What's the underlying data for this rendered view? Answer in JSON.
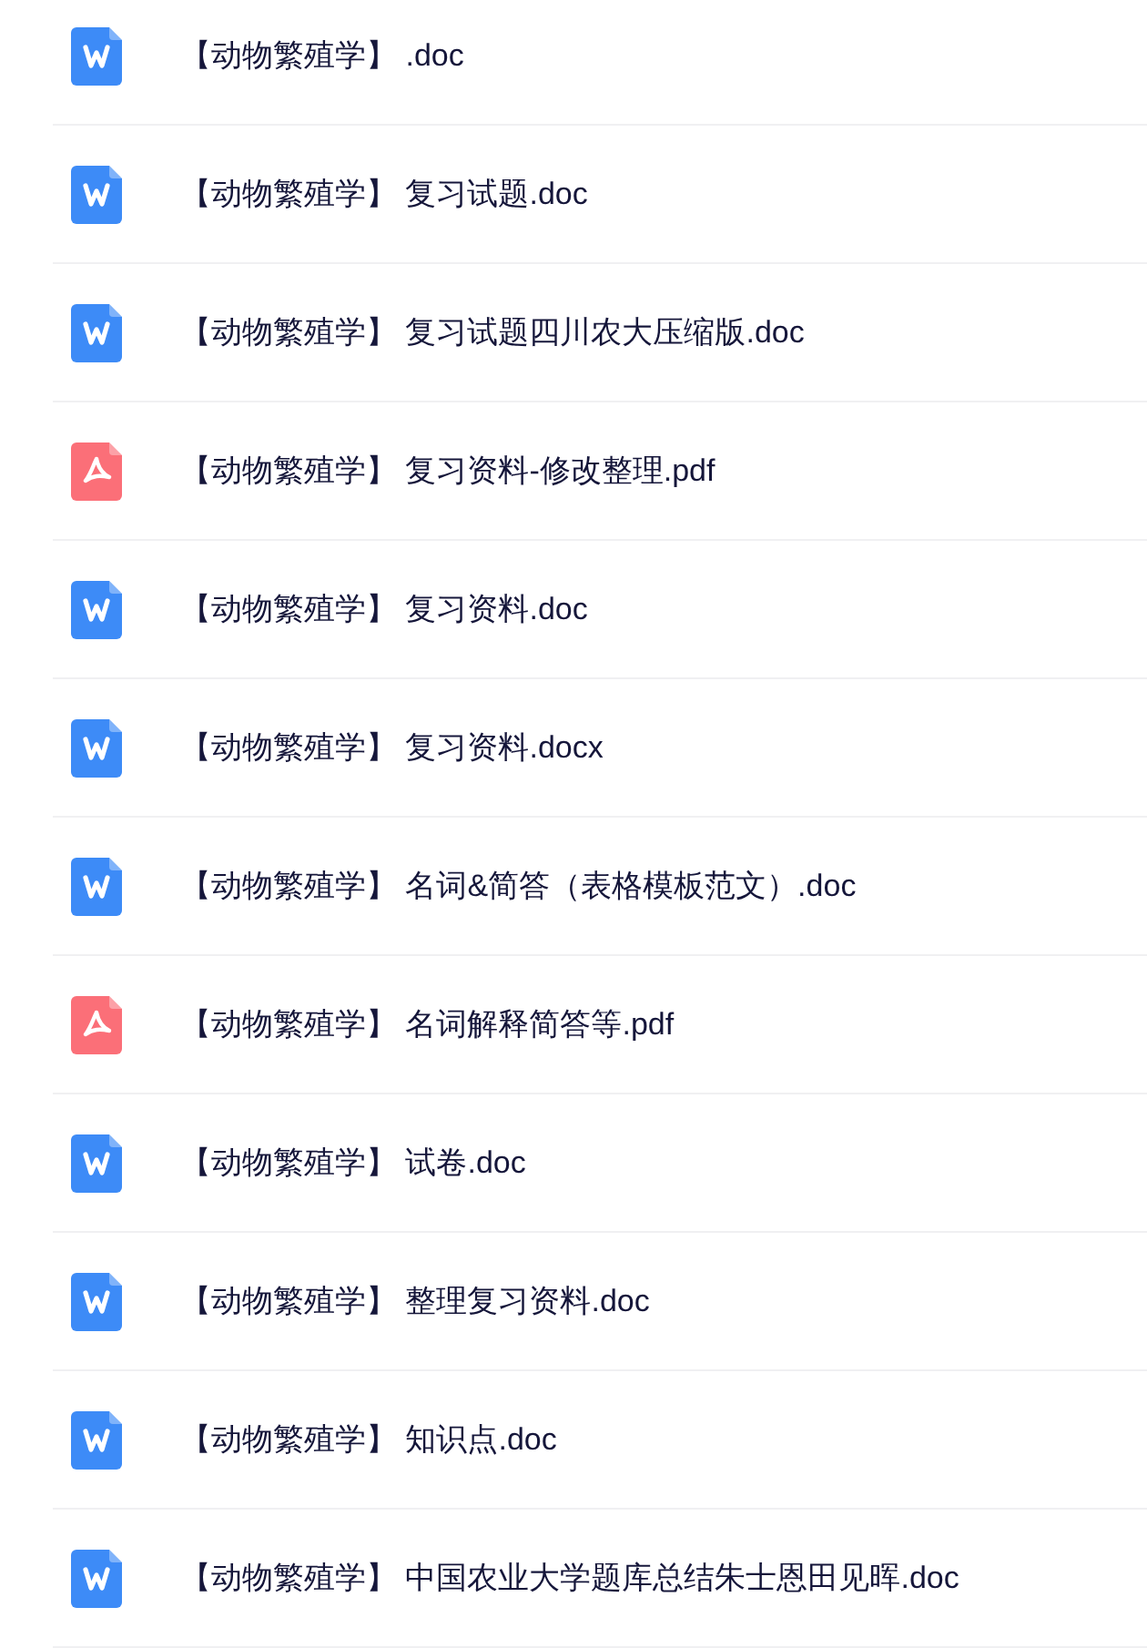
{
  "files": [
    {
      "kind": "doc",
      "name": "【动物繁殖学】 .doc"
    },
    {
      "kind": "doc",
      "name": "【动物繁殖学】 复习试题.doc"
    },
    {
      "kind": "doc",
      "name": "【动物繁殖学】 复习试题四川农大压缩版.doc"
    },
    {
      "kind": "pdf",
      "name": "【动物繁殖学】 复习资料-修改整理.pdf"
    },
    {
      "kind": "doc",
      "name": "【动物繁殖学】 复习资料.doc"
    },
    {
      "kind": "doc",
      "name": "【动物繁殖学】 复习资料.docx"
    },
    {
      "kind": "doc",
      "name": "【动物繁殖学】 名词&简答（表格模板范文）.doc"
    },
    {
      "kind": "pdf",
      "name": "【动物繁殖学】 名词解释简答等.pdf"
    },
    {
      "kind": "doc",
      "name": "【动物繁殖学】 试卷.doc"
    },
    {
      "kind": "doc",
      "name": "【动物繁殖学】 整理复习资料.doc"
    },
    {
      "kind": "doc",
      "name": "【动物繁殖学】 知识点.doc"
    },
    {
      "kind": "doc",
      "name": "【动物繁殖学】 中国农业大学题库总结朱士恩田见晖.doc"
    }
  ]
}
